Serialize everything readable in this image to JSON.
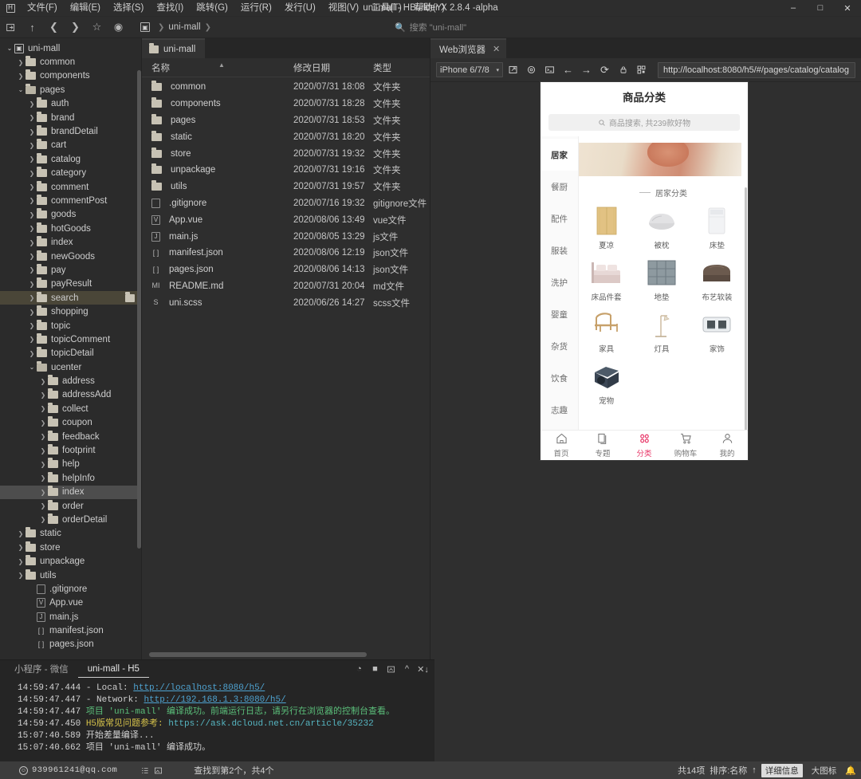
{
  "window": {
    "title": "uni-mall - HBuilder X 2.8.4 -alpha",
    "minimize": "–",
    "maximize": "□",
    "close": "✕"
  },
  "menu": {
    "logo": "H",
    "items": [
      "文件(F)",
      "编辑(E)",
      "选择(S)",
      "查找(I)",
      "跳转(G)",
      "运行(R)",
      "发行(U)",
      "视图(V)",
      "工具(T)",
      "帮助(Y)"
    ]
  },
  "toolbar": {
    "icons": [
      "open-folder-icon",
      "up-icon",
      "back-icon",
      "forward-icon",
      "star-icon",
      "run-icon"
    ],
    "breadcrumb_root": "uni-mall",
    "search_placeholder": "搜索 \"uni-mall\""
  },
  "project_tree": {
    "rows": [
      {
        "label": "uni-mall",
        "depth": 0,
        "kind": "root",
        "state": "open"
      },
      {
        "label": "common",
        "depth": 1,
        "kind": "folder",
        "state": "closed"
      },
      {
        "label": "components",
        "depth": 1,
        "kind": "folder",
        "state": "closed"
      },
      {
        "label": "pages",
        "depth": 1,
        "kind": "folder",
        "state": "open"
      },
      {
        "label": "auth",
        "depth": 2,
        "kind": "folder",
        "state": "closed"
      },
      {
        "label": "brand",
        "depth": 2,
        "kind": "folder",
        "state": "closed"
      },
      {
        "label": "brandDetail",
        "depth": 2,
        "kind": "folder",
        "state": "closed"
      },
      {
        "label": "cart",
        "depth": 2,
        "kind": "folder",
        "state": "closed"
      },
      {
        "label": "catalog",
        "depth": 2,
        "kind": "folder",
        "state": "closed"
      },
      {
        "label": "category",
        "depth": 2,
        "kind": "folder",
        "state": "closed"
      },
      {
        "label": "comment",
        "depth": 2,
        "kind": "folder",
        "state": "closed"
      },
      {
        "label": "commentPost",
        "depth": 2,
        "kind": "folder",
        "state": "closed"
      },
      {
        "label": "goods",
        "depth": 2,
        "kind": "folder",
        "state": "closed"
      },
      {
        "label": "hotGoods",
        "depth": 2,
        "kind": "folder",
        "state": "closed"
      },
      {
        "label": "index",
        "depth": 2,
        "kind": "folder",
        "state": "closed"
      },
      {
        "label": "newGoods",
        "depth": 2,
        "kind": "folder",
        "state": "closed"
      },
      {
        "label": "pay",
        "depth": 2,
        "kind": "folder",
        "state": "closed"
      },
      {
        "label": "payResult",
        "depth": 2,
        "kind": "folder",
        "state": "closed"
      },
      {
        "label": "search",
        "depth": 2,
        "kind": "folder",
        "state": "closed",
        "selected": true,
        "trailing_icon": "folder-icon"
      },
      {
        "label": "shopping",
        "depth": 2,
        "kind": "folder",
        "state": "closed"
      },
      {
        "label": "topic",
        "depth": 2,
        "kind": "folder",
        "state": "closed"
      },
      {
        "label": "topicComment",
        "depth": 2,
        "kind": "folder",
        "state": "closed"
      },
      {
        "label": "topicDetail",
        "depth": 2,
        "kind": "folder",
        "state": "closed"
      },
      {
        "label": "ucenter",
        "depth": 2,
        "kind": "folder",
        "state": "open"
      },
      {
        "label": "address",
        "depth": 3,
        "kind": "folder",
        "state": "closed"
      },
      {
        "label": "addressAdd",
        "depth": 3,
        "kind": "folder",
        "state": "closed"
      },
      {
        "label": "collect",
        "depth": 3,
        "kind": "folder",
        "state": "closed"
      },
      {
        "label": "coupon",
        "depth": 3,
        "kind": "folder",
        "state": "closed"
      },
      {
        "label": "feedback",
        "depth": 3,
        "kind": "folder",
        "state": "closed"
      },
      {
        "label": "footprint",
        "depth": 3,
        "kind": "folder",
        "state": "closed"
      },
      {
        "label": "help",
        "depth": 3,
        "kind": "folder",
        "state": "closed"
      },
      {
        "label": "helpInfo",
        "depth": 3,
        "kind": "folder",
        "state": "closed"
      },
      {
        "label": "index",
        "depth": 3,
        "kind": "folder",
        "state": "closed",
        "selected2": true
      },
      {
        "label": "order",
        "depth": 3,
        "kind": "folder",
        "state": "closed"
      },
      {
        "label": "orderDetail",
        "depth": 3,
        "kind": "folder",
        "state": "closed"
      },
      {
        "label": "static",
        "depth": 1,
        "kind": "folder",
        "state": "closed"
      },
      {
        "label": "store",
        "depth": 1,
        "kind": "folder",
        "state": "closed"
      },
      {
        "label": "unpackage",
        "depth": 1,
        "kind": "folder",
        "state": "closed"
      },
      {
        "label": "utils",
        "depth": 1,
        "kind": "folder",
        "state": "closed"
      },
      {
        "label": ".gitignore",
        "depth": 2,
        "kind": "file",
        "glyph": ""
      },
      {
        "label": "App.vue",
        "depth": 2,
        "kind": "file",
        "glyph": "V"
      },
      {
        "label": "main.js",
        "depth": 2,
        "kind": "file",
        "glyph": "J"
      },
      {
        "label": "manifest.json",
        "depth": 2,
        "kind": "file",
        "glyph": "[ ]",
        "noborder": true
      },
      {
        "label": "pages.json",
        "depth": 2,
        "kind": "file",
        "glyph": "[ ]",
        "noborder": true
      }
    ]
  },
  "file_browser": {
    "tab_label": "uni-mall",
    "columns": [
      "名称",
      "修改日期",
      "类型"
    ],
    "rows": [
      {
        "name": "common",
        "date": "2020/07/31 18:08",
        "type": "文件夹",
        "kind": "folder"
      },
      {
        "name": "components",
        "date": "2020/07/31 18:28",
        "type": "文件夹",
        "kind": "folder"
      },
      {
        "name": "pages",
        "date": "2020/07/31 18:53",
        "type": "文件夹",
        "kind": "folder"
      },
      {
        "name": "static",
        "date": "2020/07/31 18:20",
        "type": "文件夹",
        "kind": "folder"
      },
      {
        "name": "store",
        "date": "2020/07/31 19:32",
        "type": "文件夹",
        "kind": "folder"
      },
      {
        "name": "unpackage",
        "date": "2020/07/31 19:16",
        "type": "文件夹",
        "kind": "folder"
      },
      {
        "name": "utils",
        "date": "2020/07/31 19:57",
        "type": "文件夹",
        "kind": "folder"
      },
      {
        "name": ".gitignore",
        "date": "2020/07/16 19:32",
        "type": "gitignore文件",
        "kind": "file",
        "glyph": ""
      },
      {
        "name": "App.vue",
        "date": "2020/08/06 13:49",
        "type": "vue文件",
        "kind": "file",
        "glyph": "V"
      },
      {
        "name": "main.js",
        "date": "2020/08/05 13:29",
        "type": "js文件",
        "kind": "file",
        "glyph": "J"
      },
      {
        "name": "manifest.json",
        "date": "2020/08/06 12:19",
        "type": "json文件",
        "kind": "file",
        "glyph": "[ ]",
        "noborder": true
      },
      {
        "name": "pages.json",
        "date": "2020/08/06 14:13",
        "type": "json文件",
        "kind": "file",
        "glyph": "[ ]",
        "noborder": true
      },
      {
        "name": "README.md",
        "date": "2020/07/31 20:04",
        "type": "md文件",
        "kind": "file",
        "glyph": "MI",
        "noborder": true
      },
      {
        "name": "uni.scss",
        "date": "2020/06/26 14:27",
        "type": "scss文件",
        "kind": "file",
        "glyph": "S",
        "noborder": true
      }
    ]
  },
  "browser": {
    "tab_label": "Web浏览器",
    "tab_close": "✕",
    "device": "iPhone 6/7/8",
    "device_caret": "▾",
    "icons": [
      "popout-icon",
      "settings-icon",
      "console-icon",
      "back-icon",
      "forward-icon",
      "reload-icon",
      "lock-icon",
      "qrcode-icon"
    ],
    "url": "http://localhost:8080/h5/#/pages/catalog/catalog"
  },
  "phone_preview": {
    "title": "商品分类",
    "search_placeholder": "商品搜索, 共239款好物",
    "search_icon": "search-icon",
    "side_categories": [
      {
        "label": "居家",
        "active": true
      },
      {
        "label": "餐厨",
        "active": false
      },
      {
        "label": "配件",
        "active": false
      },
      {
        "label": "服装",
        "active": false
      },
      {
        "label": "洗护",
        "active": false
      },
      {
        "label": "婴童",
        "active": false
      },
      {
        "label": "杂货",
        "active": false
      },
      {
        "label": "饮食",
        "active": false
      },
      {
        "label": "志趣",
        "active": false
      }
    ],
    "section_title": "居家分类",
    "grid_items": [
      {
        "label": "夏凉",
        "thumb": "mat-thumb"
      },
      {
        "label": "被枕",
        "thumb": "pillow-thumb"
      },
      {
        "label": "床垫",
        "thumb": "mattress-thumb"
      },
      {
        "label": "床品件套",
        "thumb": "bedding-thumb"
      },
      {
        "label": "地垫",
        "thumb": "rug-thumb"
      },
      {
        "label": "布艺软装",
        "thumb": "sofa-thumb"
      },
      {
        "label": "家具",
        "thumb": "chair-thumb"
      },
      {
        "label": "灯具",
        "thumb": "lamp-thumb"
      },
      {
        "label": "家饰",
        "thumb": "clock-thumb"
      },
      {
        "label": "宠物",
        "thumb": "pet-thumb"
      }
    ],
    "tabbar": [
      {
        "label": "首页",
        "icon": "home-icon",
        "active": false
      },
      {
        "label": "专题",
        "icon": "topic-icon",
        "active": false
      },
      {
        "label": "分类",
        "icon": "category-icon",
        "active": true
      },
      {
        "label": "购物车",
        "icon": "cart-icon",
        "active": false
      },
      {
        "label": "我的",
        "icon": "user-icon",
        "active": false
      }
    ],
    "active_color": "#e8396a"
  },
  "console": {
    "tabs": [
      {
        "label": "小程序 - 微信",
        "active": false
      },
      {
        "label": "uni-mall - H5",
        "active": true
      }
    ],
    "icons": [
      "run-icon",
      "stop-icon",
      "clear-icon",
      "collapse-icon",
      "close-all-icon"
    ],
    "lines": [
      {
        "time": "14:59:47.444",
        "parts": [
          {
            "t": " - Local:   ",
            "c": "lbl"
          },
          {
            "t": "http://localhost:8080/h5/",
            "c": "lnk"
          }
        ]
      },
      {
        "time": "14:59:47.447",
        "parts": [
          {
            "t": " - Network: ",
            "c": "lbl"
          },
          {
            "t": "http://192.168.1.3:8080/h5/",
            "c": "lnk"
          }
        ]
      },
      {
        "time": "14:59:47.447",
        "parts": [
          {
            "t": "项目 'uni-mall' 编译成功。前端运行日志，请另行在浏览器的控制台查看。",
            "c": "grn"
          }
        ]
      },
      {
        "time": "14:59:47.450",
        "parts": [
          {
            "t": "H5版常见问题参考: ",
            "c": "ylw"
          },
          {
            "t": "https://ask.dcloud.net.cn/article/35232",
            "c": "cyn"
          }
        ]
      },
      {
        "time": "15:07:40.589",
        "parts": [
          {
            "t": "开始差量编译...",
            "c": "lbl"
          }
        ]
      },
      {
        "time": "15:07:40.662",
        "parts": [
          {
            "t": "项目 'uni-mall' 编译成功。",
            "c": "lbl"
          }
        ]
      }
    ]
  },
  "statusbar": {
    "account": "939961241@qq.com",
    "account_icon": "user-circle-icon",
    "icons": [
      "list-icon",
      "image-icon"
    ],
    "found": "查找到第2个，共4个",
    "total": "共14项",
    "sort": "排序:名称",
    "sort_arrow": "↑",
    "view_detail": "详细信息",
    "view_large": "大图标",
    "bell": "bell-icon"
  }
}
